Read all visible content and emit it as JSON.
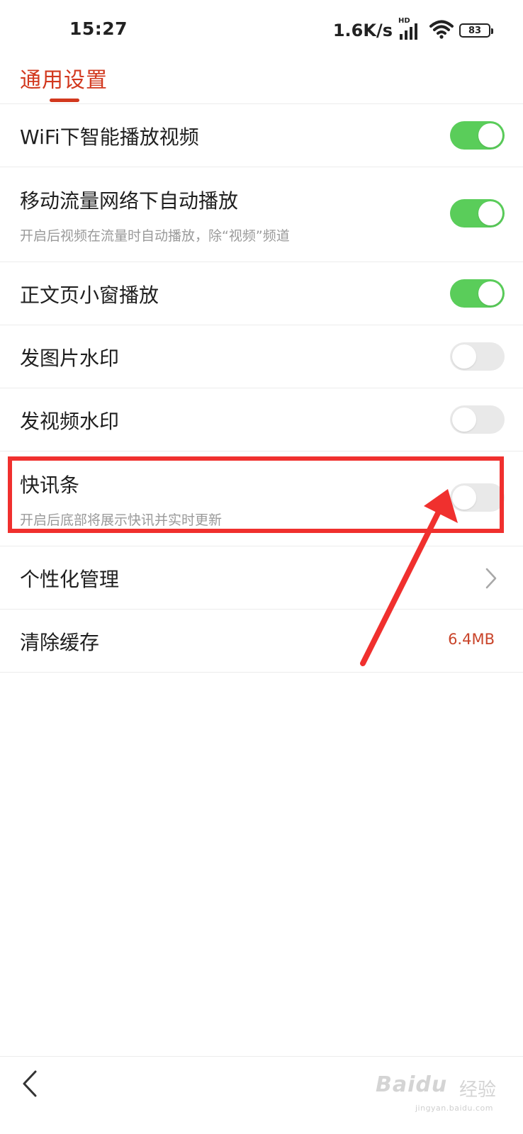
{
  "status_bar": {
    "time": "15:27",
    "net_speed": "1.6K/s",
    "hd": "HD",
    "battery": "83"
  },
  "header": {
    "title": "通用设置"
  },
  "settings": [
    {
      "label": "WiFi下智能播放视频",
      "toggle": "on"
    },
    {
      "label": "移动流量网络下自动播放",
      "desc": "开启后视频在流量时自动播放，除“视频”频道",
      "toggle": "on"
    },
    {
      "label": "正文页小窗播放",
      "toggle": "on"
    },
    {
      "label": "发图片水印",
      "toggle": "off"
    },
    {
      "label": "发视频水印",
      "toggle": "off"
    },
    {
      "label": "快讯条",
      "desc": "开启后底部将展示快讯并实时更新",
      "toggle": "off"
    },
    {
      "label": "个性化管理"
    },
    {
      "label": "清除缓存",
      "value": "6.4MB"
    }
  ],
  "watermark": {
    "brand": "Baidu",
    "cn": "经验",
    "url": "jingyan.baidu.com"
  },
  "colors": {
    "accent": "#d2381e",
    "toggle_on": "#5acd5a",
    "toggle_off": "#e9e9e9",
    "annotation": "#f0302e"
  },
  "icons": {
    "back": "chevron-left-icon",
    "row_chevron": "chevron-right-icon",
    "wifi": "wifi-icon",
    "signal": "signal-bars-icon",
    "battery": "battery-icon"
  }
}
